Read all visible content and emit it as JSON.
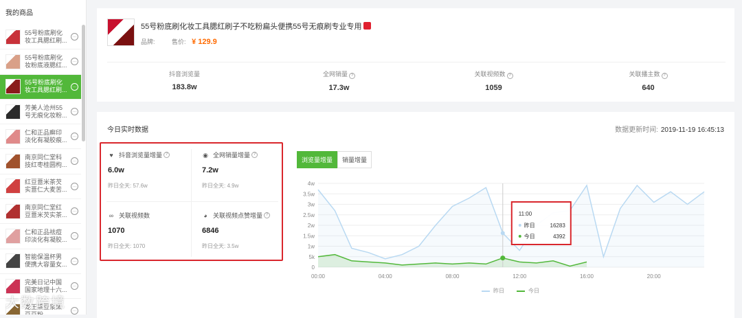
{
  "sidebar": {
    "title": "我的商品",
    "items": [
      {
        "label": "55号粉底刷化妆工具腮红刷...",
        "thumb_color": "#c8323a",
        "active": false
      },
      {
        "label": "55号粉底刷化妆粉底液腮红...",
        "thumb_color": "#d9a088",
        "active": false
      },
      {
        "label": "55号粉底刷化妆工具腮红刷...",
        "thumb_color": "#8a1c1c",
        "active": true
      },
      {
        "label": "芳美人沧州55号无痕化妆粉...",
        "thumb_color": "#2b2b2b",
        "active": false
      },
      {
        "label": "仁和正品癣印淡化有凝胶痕...",
        "thumb_color": "#e08a8a",
        "active": false
      },
      {
        "label": "南京同仁堂科技红枣桂圆枸...",
        "thumb_color": "#a0522d",
        "active": false
      },
      {
        "label": "红豆薏米茶芡实薏仁大麦苦...",
        "thumb_color": "#d04040",
        "active": false
      },
      {
        "label": "南京同仁堂红豆薏米芡实茶...",
        "thumb_color": "#b03030",
        "active": false
      },
      {
        "label": "仁和正品祛痘印淡化有凝胶...",
        "thumb_color": "#e0a0a0",
        "active": false
      },
      {
        "label": "智能保温杯男便携大容量女...",
        "thumb_color": "#444444",
        "active": false
      },
      {
        "label": "完美日记中国国家地理十六...",
        "thumb_color": "#cc3355",
        "active": false
      },
      {
        "label": "龙王蒸豆浆黑豆豆粉...",
        "thumb_color": "#886633",
        "active": false
      }
    ]
  },
  "product": {
    "title": "55号粉底刷化妆工具腮红刷子不吃粉扁头便携55号无痕刷专业专用",
    "brand_label": "品牌:",
    "price_label": "售价:",
    "price": "¥ 129.9"
  },
  "stats": [
    {
      "label": "抖音浏览量",
      "value": "183.8w",
      "help": false
    },
    {
      "label": "全网销量",
      "value": "17.3w",
      "help": true
    },
    {
      "label": "关联视频数",
      "value": "1059",
      "help": true
    },
    {
      "label": "关联播主数",
      "value": "640",
      "help": true
    }
  ],
  "realtime": {
    "title": "今日实时数据",
    "update_label": "数据更新时间:",
    "update_time": "2019-11-19 16:45:13",
    "metrics": [
      {
        "icon": "heart-icon",
        "label": "抖音浏览量增量",
        "value": "6.0w",
        "yesterday": "昨日全天: 57.6w"
      },
      {
        "icon": "eye-icon",
        "label": "全网销量增量",
        "value": "7.2w",
        "yesterday": "昨日全天: 4.9w"
      },
      {
        "icon": "link-icon",
        "label": "关联视频数",
        "value": "1070",
        "yesterday": "昨日全天: 1070"
      },
      {
        "icon": "compass-icon",
        "label": "关联视频点赞增量",
        "value": "6846",
        "yesterday": "昨日全天: 3.5w"
      }
    ],
    "tabs": [
      {
        "label": "浏览量增量",
        "active": true
      },
      {
        "label": "销量增量",
        "active": false
      }
    ]
  },
  "chart_data": {
    "type": "line",
    "x_ticks": [
      "00:00",
      "04:00",
      "08:00",
      "12:00",
      "16:00",
      "20:00"
    ],
    "y_ticks": [
      "0",
      "5k",
      "1w",
      "1.5w",
      "2w",
      "2.5w",
      "3w",
      "3.5w",
      "4w"
    ],
    "ylim": [
      0,
      40000
    ],
    "xlim": [
      0,
      23
    ],
    "series": [
      {
        "name": "昨日",
        "color": "#b9d9f2",
        "x": [
          0,
          1,
          2,
          3,
          4,
          5,
          6,
          7,
          8,
          9,
          10,
          11,
          12,
          13,
          14,
          15,
          16,
          17,
          18,
          19,
          20,
          21,
          22,
          23
        ],
        "y": [
          37000,
          27000,
          9000,
          7000,
          4000,
          6000,
          10000,
          20000,
          29000,
          33000,
          38000,
          16283,
          8000,
          20000,
          26000,
          27000,
          39000,
          5000,
          28000,
          39000,
          31000,
          36000,
          30000,
          36000
        ]
      },
      {
        "name": "今日",
        "color": "#52b83a",
        "x": [
          0,
          1,
          2,
          3,
          4,
          5,
          6,
          7,
          8,
          9,
          10,
          11,
          12,
          13,
          14,
          15,
          16
        ],
        "y": [
          5000,
          6000,
          3000,
          2500,
          2000,
          1000,
          1500,
          2000,
          1500,
          2000,
          1500,
          4392,
          2500,
          2000,
          3000,
          500,
          2500
        ]
      }
    ],
    "tooltip": {
      "time": "11:00",
      "rows": [
        {
          "label": "昨日",
          "value": "16283"
        },
        {
          "label": "今日",
          "value": "4392"
        }
      ]
    }
  },
  "watermark": "大数跨境"
}
